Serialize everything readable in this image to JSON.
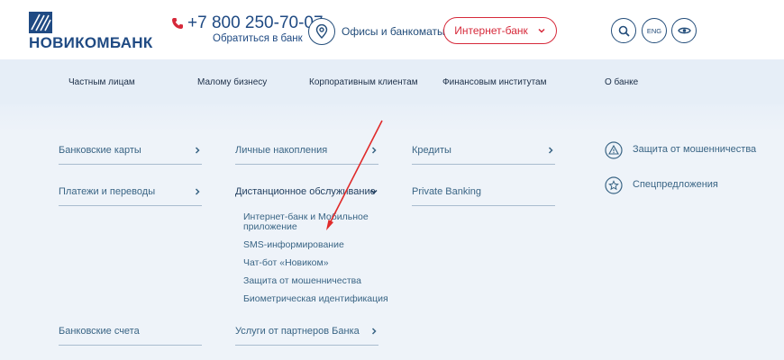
{
  "header": {
    "logo_text": "НОВИКОМБАНК",
    "phone_number": "+7 800 250-70-07",
    "phone_sub": "Обратиться в банк",
    "offices_label": "Офисы и банкоматы",
    "internet_bank_label": "Интернет-банк",
    "lang_label": "ENG",
    "brand_color": "#1f4a83",
    "accent_color": "#d6293a"
  },
  "topnav": {
    "items": [
      "Частным лицам",
      "Малому бизнесу",
      "Корпоративным клиентам",
      "Финансовым институтам",
      "О банке"
    ]
  },
  "menu": {
    "col1": [
      "Банковские карты",
      "Платежи и переводы",
      "Банковские счета"
    ],
    "col2": [
      "Личные накопления",
      "Дистанционное обслуживание",
      "Услуги от партнеров Банка"
    ],
    "col3": [
      "Кредиты",
      "Private Banking"
    ],
    "submenu": [
      "Интернет-банк и Мобильное",
      "приложение",
      "SMS-информирование",
      "Чат-бот «Новиком»",
      "Защита от мошенничества",
      "Биометрическая идентификация"
    ],
    "side": [
      "Защита от мошенничества",
      "Спецпредложения"
    ]
  },
  "icons": {
    "phone": "phone-icon",
    "offices": "location-pin-icon",
    "search": "search-icon",
    "eye": "eye-icon",
    "warning": "warning-icon",
    "star": "star-icon",
    "chevron": "chevron-icon"
  }
}
